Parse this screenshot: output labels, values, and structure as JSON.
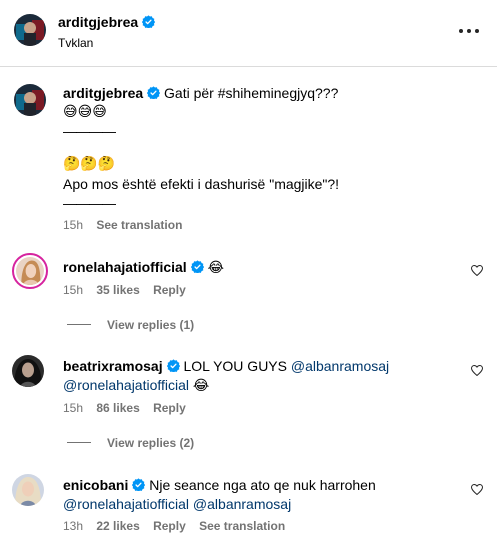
{
  "post_header": {
    "username": "arditgjebrea",
    "location": "Tvklan",
    "more_icon": "more-horizontal-icon"
  },
  "caption": {
    "username": "arditgjebrea",
    "line1": "Gati për #shiheminegjyq???",
    "emoji_row1": "😅😅😅",
    "divider1": "————",
    "emoji_row2": "🤔🤔🤔",
    "line3": "Apo mos është efekti i dashurisë \"magjike\"?!",
    "divider2": "————",
    "time": "15h",
    "see_translation": "See translation"
  },
  "comments": [
    {
      "username": "ronelahajatiofficial",
      "text_prefix": "",
      "emoji": "😂",
      "time": "15h",
      "likes": "35 likes",
      "reply": "Reply",
      "view_replies": "View replies (1)"
    },
    {
      "username": "beatrixramosaj",
      "text_prefix": "LOL YOU GUYS",
      "mention1": "@albanramosaj",
      "mention2": "@ronelahajatiofficial",
      "emoji": "😂",
      "time": "15h",
      "likes": "86 likes",
      "reply": "Reply",
      "view_replies": "View replies (2)"
    },
    {
      "username": "enicobani",
      "text_prefix": "Nje seance nga ato qe nuk harrohen",
      "mention1": "@ronelahajatiofficial",
      "mention2": "@albanramosaj",
      "time": "13h",
      "likes": "22 likes",
      "reply": "Reply",
      "see_translation": "See translation"
    }
  ],
  "colors": {
    "verified_blue": "#0095f6",
    "mention": "#00376b",
    "secondary_text": "#737373",
    "story_ring": "#d6249f"
  }
}
